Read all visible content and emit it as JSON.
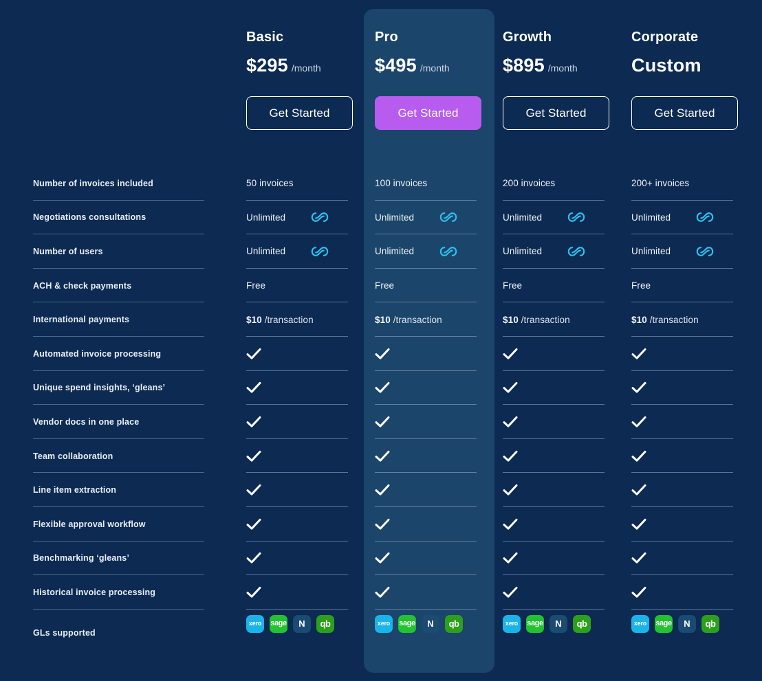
{
  "colors": {
    "page_background": "#0c2a52",
    "highlight_card_background": "#1b456a",
    "primary_cta": "#b85cf0",
    "infinity_icon": "#2ec2ef",
    "check_icon": "#ffffff",
    "divider": "#9fb3c8"
  },
  "plans": [
    {
      "name": "Basic",
      "price": "$295",
      "period": "/month",
      "cta_label": "Get Started",
      "highlighted": false
    },
    {
      "name": "Pro",
      "price": "$495",
      "period": "/month",
      "cta_label": "Get Started",
      "highlighted": true
    },
    {
      "name": "Growth",
      "price": "$895",
      "period": "/month",
      "cta_label": "Get Started",
      "highlighted": false
    },
    {
      "name": "Corporate",
      "price": "Custom",
      "period": "",
      "cta_label": "Get Started",
      "highlighted": false
    }
  ],
  "features": [
    {
      "label": "Number of invoices included",
      "values": [
        {
          "type": "text",
          "text": "50 invoices"
        },
        {
          "type": "text",
          "text": "100 invoices"
        },
        {
          "type": "text",
          "text": "200 invoices"
        },
        {
          "type": "text",
          "text": "200+ invoices"
        }
      ]
    },
    {
      "label": "Negotiations consultations",
      "values": [
        {
          "type": "text-icon",
          "text": "Unlimited",
          "icon": "infinity-icon"
        },
        {
          "type": "text-icon",
          "text": "Unlimited",
          "icon": "infinity-icon"
        },
        {
          "type": "text-icon",
          "text": "Unlimited",
          "icon": "infinity-icon"
        },
        {
          "type": "text-icon",
          "text": "Unlimited",
          "icon": "infinity-icon"
        }
      ]
    },
    {
      "label": "Number of users",
      "values": [
        {
          "type": "text-icon",
          "text": "Unlimited",
          "icon": "infinity-icon"
        },
        {
          "type": "text-icon",
          "text": "Unlimited",
          "icon": "infinity-icon"
        },
        {
          "type": "text-icon",
          "text": "Unlimited",
          "icon": "infinity-icon"
        },
        {
          "type": "text-icon",
          "text": "Unlimited",
          "icon": "infinity-icon"
        }
      ]
    },
    {
      "label": "ACH & check payments",
      "values": [
        {
          "type": "text",
          "text": "Free"
        },
        {
          "type": "text",
          "text": "Free"
        },
        {
          "type": "text",
          "text": "Free"
        },
        {
          "type": "text",
          "text": "Free"
        }
      ]
    },
    {
      "label": "International payments",
      "values": [
        {
          "type": "amount-unit",
          "amount": "$10",
          "unit": "/transaction"
        },
        {
          "type": "amount-unit",
          "amount": "$10",
          "unit": "/transaction"
        },
        {
          "type": "amount-unit",
          "amount": "$10",
          "unit": "/transaction"
        },
        {
          "type": "amount-unit",
          "amount": "$10",
          "unit": "/transaction"
        }
      ]
    },
    {
      "label": "Automated invoice processing",
      "values": [
        {
          "type": "check",
          "icon": "check-icon"
        },
        {
          "type": "check",
          "icon": "check-icon"
        },
        {
          "type": "check",
          "icon": "check-icon"
        },
        {
          "type": "check",
          "icon": "check-icon"
        }
      ]
    },
    {
      "label": "Unique spend insights, ‘gleans’",
      "values": [
        {
          "type": "check",
          "icon": "check-icon"
        },
        {
          "type": "check",
          "icon": "check-icon"
        },
        {
          "type": "check",
          "icon": "check-icon"
        },
        {
          "type": "check",
          "icon": "check-icon"
        }
      ]
    },
    {
      "label": "Vendor docs in one place",
      "values": [
        {
          "type": "check",
          "icon": "check-icon"
        },
        {
          "type": "check",
          "icon": "check-icon"
        },
        {
          "type": "check",
          "icon": "check-icon"
        },
        {
          "type": "check",
          "icon": "check-icon"
        }
      ]
    },
    {
      "label": "Team collaboration",
      "values": [
        {
          "type": "check",
          "icon": "check-icon"
        },
        {
          "type": "check",
          "icon": "check-icon"
        },
        {
          "type": "check",
          "icon": "check-icon"
        },
        {
          "type": "check",
          "icon": "check-icon"
        }
      ]
    },
    {
      "label": "Line item extraction",
      "values": [
        {
          "type": "check",
          "icon": "check-icon"
        },
        {
          "type": "check",
          "icon": "check-icon"
        },
        {
          "type": "check",
          "icon": "check-icon"
        },
        {
          "type": "check",
          "icon": "check-icon"
        }
      ]
    },
    {
      "label": "Flexible approval workflow",
      "values": [
        {
          "type": "check",
          "icon": "check-icon"
        },
        {
          "type": "check",
          "icon": "check-icon"
        },
        {
          "type": "check",
          "icon": "check-icon"
        },
        {
          "type": "check",
          "icon": "check-icon"
        }
      ]
    },
    {
      "label": "Benchmarking ‘gleans’",
      "values": [
        {
          "type": "check",
          "icon": "check-icon"
        },
        {
          "type": "check",
          "icon": "check-icon"
        },
        {
          "type": "check",
          "icon": "check-icon"
        },
        {
          "type": "check",
          "icon": "check-icon"
        }
      ]
    },
    {
      "label": "Historical invoice processing",
      "values": [
        {
          "type": "check",
          "icon": "check-icon"
        },
        {
          "type": "check",
          "icon": "check-icon"
        },
        {
          "type": "check",
          "icon": "check-icon"
        },
        {
          "type": "check",
          "icon": "check-icon"
        }
      ]
    }
  ],
  "gl_row": {
    "label": "GLs supported",
    "logos": [
      {
        "name": "xero-logo",
        "text": "xero",
        "class": "gl-xero"
      },
      {
        "name": "sage-logo",
        "text": "sage",
        "class": "gl-sage"
      },
      {
        "name": "netsuite-logo",
        "text": "N",
        "class": "gl-netsuite"
      },
      {
        "name": "quickbooks-logo",
        "text": "qb",
        "class": "gl-qb"
      }
    ]
  }
}
